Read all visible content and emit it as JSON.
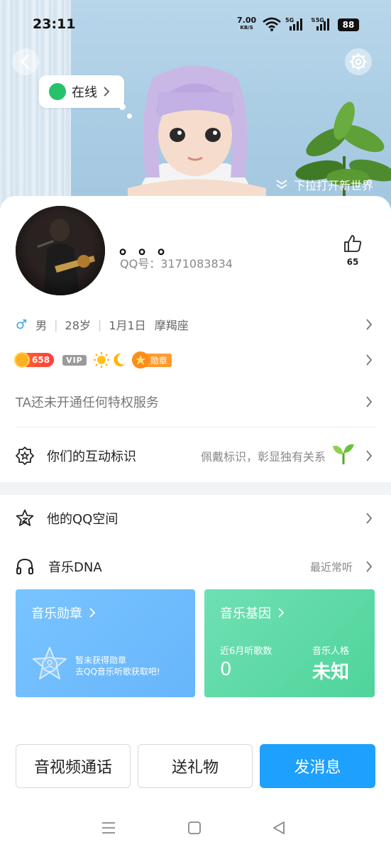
{
  "status_bar": {
    "time": "23:11",
    "net_speed": "7.00",
    "net_unit": "KB/S",
    "battery": "88"
  },
  "header": {
    "online_status": "在线",
    "pull_hint": "下拉打开新世界"
  },
  "profile": {
    "nickname": "。。。",
    "qq_number": "QQ号：3171083834",
    "likes": "65",
    "gender": "男",
    "age": "28岁",
    "birthday": "1月1日",
    "zodiac": "摩羯座",
    "level": "658",
    "vip_label": "VIP",
    "medal_label": "勋章",
    "privilege_text": "TA还未开通任何特权服务"
  },
  "interaction": {
    "label": "你们的互动标识",
    "hint": "佩戴标识，彰显独有关系"
  },
  "qzone": {
    "label": "他的QQ空间"
  },
  "music": {
    "label": "音乐DNA",
    "hint": "最近常听",
    "medal_card": {
      "title": "音乐勋章",
      "desc_line1": "暂未获得勋章",
      "desc_line2": "去QQ音乐听歌获取吧!"
    },
    "gene_card": {
      "title": "音乐基因",
      "stat1_label": "近6月听歌数",
      "stat1_value": "0",
      "stat2_label": "音乐人格",
      "stat2_value": "未知"
    }
  },
  "actions": {
    "call": "音视频通话",
    "gift": "送礼物",
    "message": "发消息"
  },
  "colors": {
    "accent_blue": "#1ea0ff",
    "online_green": "#25c26a",
    "music_blue": "#6bb8fc",
    "music_green": "#55d69f"
  }
}
